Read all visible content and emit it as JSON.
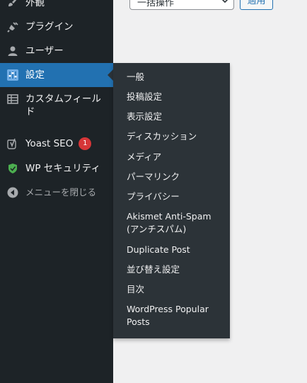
{
  "content": {
    "bulk_action_value": "一括操作",
    "apply_label": "適用"
  },
  "sidebar": {
    "items": [
      {
        "label": "外観",
        "icon": "brush-icon"
      },
      {
        "label": "プラグイン",
        "icon": "plugin-icon"
      },
      {
        "label": "ユーザー",
        "icon": "user-icon"
      },
      {
        "label": "設定",
        "icon": "settings-sliders-icon",
        "active": true
      },
      {
        "label": "カスタムフィールド",
        "icon": "table-icon"
      },
      {
        "label": "Yoast SEO",
        "icon": "yoast-icon",
        "badge": "1"
      },
      {
        "label": "WP セキュリティ",
        "icon": "shield-icon"
      },
      {
        "label": "メニューを閉じる",
        "icon": "collapse-icon"
      }
    ]
  },
  "flyout": {
    "items": [
      "一般",
      "投稿設定",
      "表示設定",
      "ディスカッション",
      "メディア",
      "パーマリンク",
      "プライバシー",
      "Akismet Anti-Spam (アンチスパム)",
      "Duplicate Post",
      "並び替え設定",
      "目次",
      "WordPress Popular Posts"
    ]
  },
  "colors": {
    "sidebar_bg": "#1d2327",
    "flyout_bg": "#2c3338",
    "active_bg": "#2271b1",
    "badge_bg": "#d63638",
    "shield_green": "#4caf50"
  }
}
